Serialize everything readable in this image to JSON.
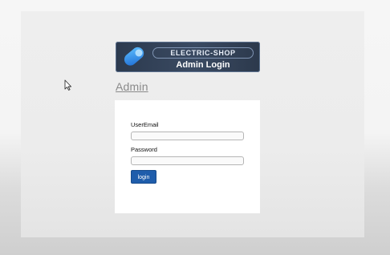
{
  "logo": {
    "brand": "ELECTRIC-SHOP",
    "title": "Admin Login"
  },
  "heading": "Admin",
  "form": {
    "email_label": "UserEmail",
    "email_value": "",
    "password_label": "Password",
    "password_value": "",
    "login_label": "login"
  },
  "colors": {
    "button": "#1f5dab",
    "logo_bg": "#34435a",
    "logo_accent": "#3f9be8"
  },
  "icons": {
    "logo_mark": "electric-shop-logo-icon",
    "cursor": "mouse-pointer-icon"
  }
}
